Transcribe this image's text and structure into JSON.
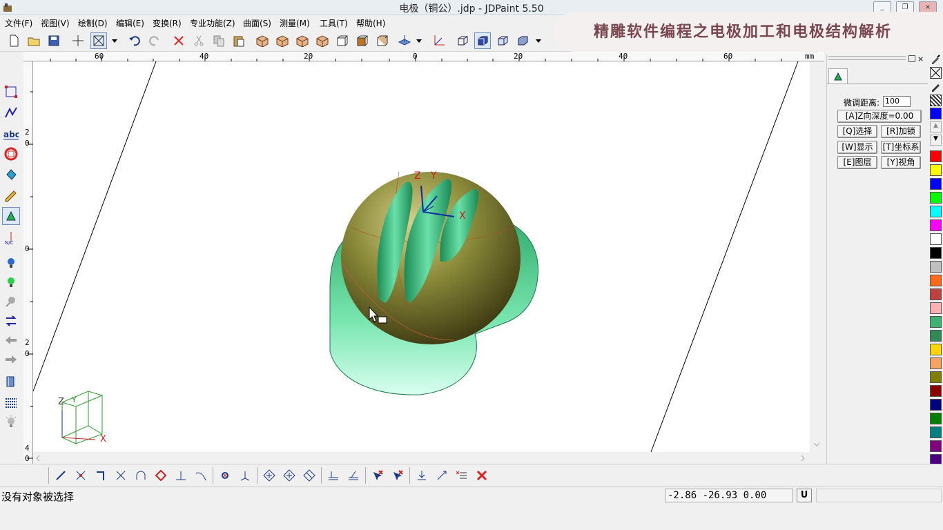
{
  "window": {
    "title": "电极（铜公）.jdp - JDPaint 5.50",
    "min": "_",
    "restore": "❐",
    "close": "×"
  },
  "menu": [
    "文件(F)",
    "视图(V)",
    "绘制(D)",
    "编辑(E)",
    "变换(R)",
    "专业功能(Z)",
    "曲面(S)",
    "测量(M)",
    "工具(T)",
    "帮助(H)"
  ],
  "banner": {
    "text": "精雕软件编程之电极加工和电极结构解析"
  },
  "ruler": {
    "unit": "mm",
    "top_labels": [
      "60",
      "40",
      "20",
      "0",
      "20",
      "40",
      "60"
    ],
    "left_labels": [
      "2",
      "0",
      "0",
      "2",
      "0",
      "4",
      "0"
    ]
  },
  "canvas": {
    "axis_z": "Z",
    "axis_y": "Y",
    "axis_x": "X",
    "cube_z": "Z",
    "cube_y": "Y",
    "cube_x": "X"
  },
  "panel": {
    "tab_icon": "brush-icon",
    "nudge_label": "微调距离:",
    "nudge_value": "100",
    "z_depth": "[A]Z向深度=0.00",
    "btn_select": "[Q]选择",
    "btn_lock": "[R]加锁",
    "btn_display": "[W]显示",
    "btn_coord": "[T]坐标系",
    "btn_layer": "[E]图层",
    "btn_view": "[Y]视角"
  },
  "palette": [
    "#0000ff",
    "#ff0000",
    "#ffff00",
    "#0000ff",
    "#00ff00",
    "#00ffff",
    "#ff00ff",
    "#ffffff",
    "#000000",
    "#c0c0c0",
    "#ff6a1a",
    "#c04040",
    "#ffb0b0",
    "#3cb371",
    "#2e8b57",
    "#ffd700",
    "#f4a460",
    "#808000",
    "#8b0000",
    "#000080",
    "#008000",
    "#008080",
    "#800080",
    "#4b0082"
  ],
  "status": {
    "message": "没有对象被选择",
    "coords": "-2.86 -26.93 0.00",
    "u_button": "U"
  }
}
